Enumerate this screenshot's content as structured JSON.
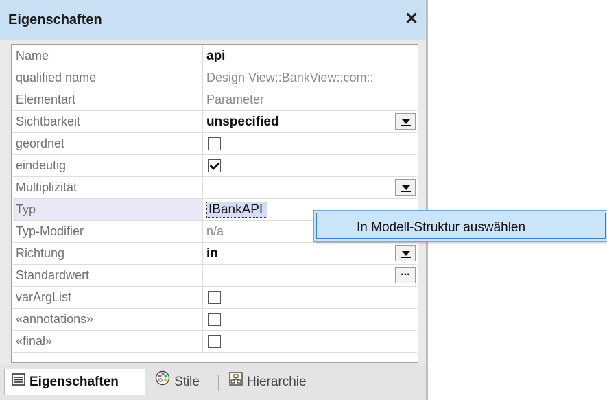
{
  "window": {
    "title": "Eigenschaften",
    "close_glyph": "✕"
  },
  "properties": [
    {
      "name": "Name",
      "value": "api",
      "kind": "text"
    },
    {
      "name": "qualified name",
      "value": "Design View::BankView::com::",
      "kind": "readonly"
    },
    {
      "name": "Elementart",
      "value": "Parameter",
      "kind": "readonly"
    },
    {
      "name": "Sichtbarkeit",
      "value": "unspecified",
      "kind": "dropdown"
    },
    {
      "name": "geordnet",
      "value": "",
      "kind": "checkbox",
      "checked": false
    },
    {
      "name": "eindeutig",
      "value": "",
      "kind": "checkbox",
      "checked": true
    },
    {
      "name": "Multiplizität",
      "value": "",
      "kind": "dropdown"
    },
    {
      "name": "Typ",
      "value": "IBankAPI",
      "kind": "editing"
    },
    {
      "name": "Typ-Modifier",
      "value": "n/a",
      "kind": "readonly"
    },
    {
      "name": "Richtung",
      "value": "in",
      "kind": "dropdown"
    },
    {
      "name": "Standardwert",
      "value": "",
      "kind": "ellipsis"
    },
    {
      "name": "varArgList",
      "value": "",
      "kind": "checkbox",
      "checked": false
    },
    {
      "name": "«annotations»",
      "value": "",
      "kind": "checkbox",
      "checked": false
    },
    {
      "name": "«final»",
      "value": "",
      "kind": "checkbox",
      "checked": false
    }
  ],
  "context_menu": {
    "item": "In Modell-Struktur auswählen"
  },
  "tabs": [
    {
      "label": "Eigenschaften",
      "icon": "properties-icon",
      "active": true
    },
    {
      "label": "Stile",
      "icon": "palette-icon",
      "active": false
    },
    {
      "label": "Hierarchie",
      "icon": "hierarchy-icon",
      "active": false
    }
  ],
  "ellipsis_label": "...",
  "colors": {
    "titlebar": "#c9dff4",
    "selection": "#d6dcf4",
    "menu_highlight": "#cce4f7"
  }
}
